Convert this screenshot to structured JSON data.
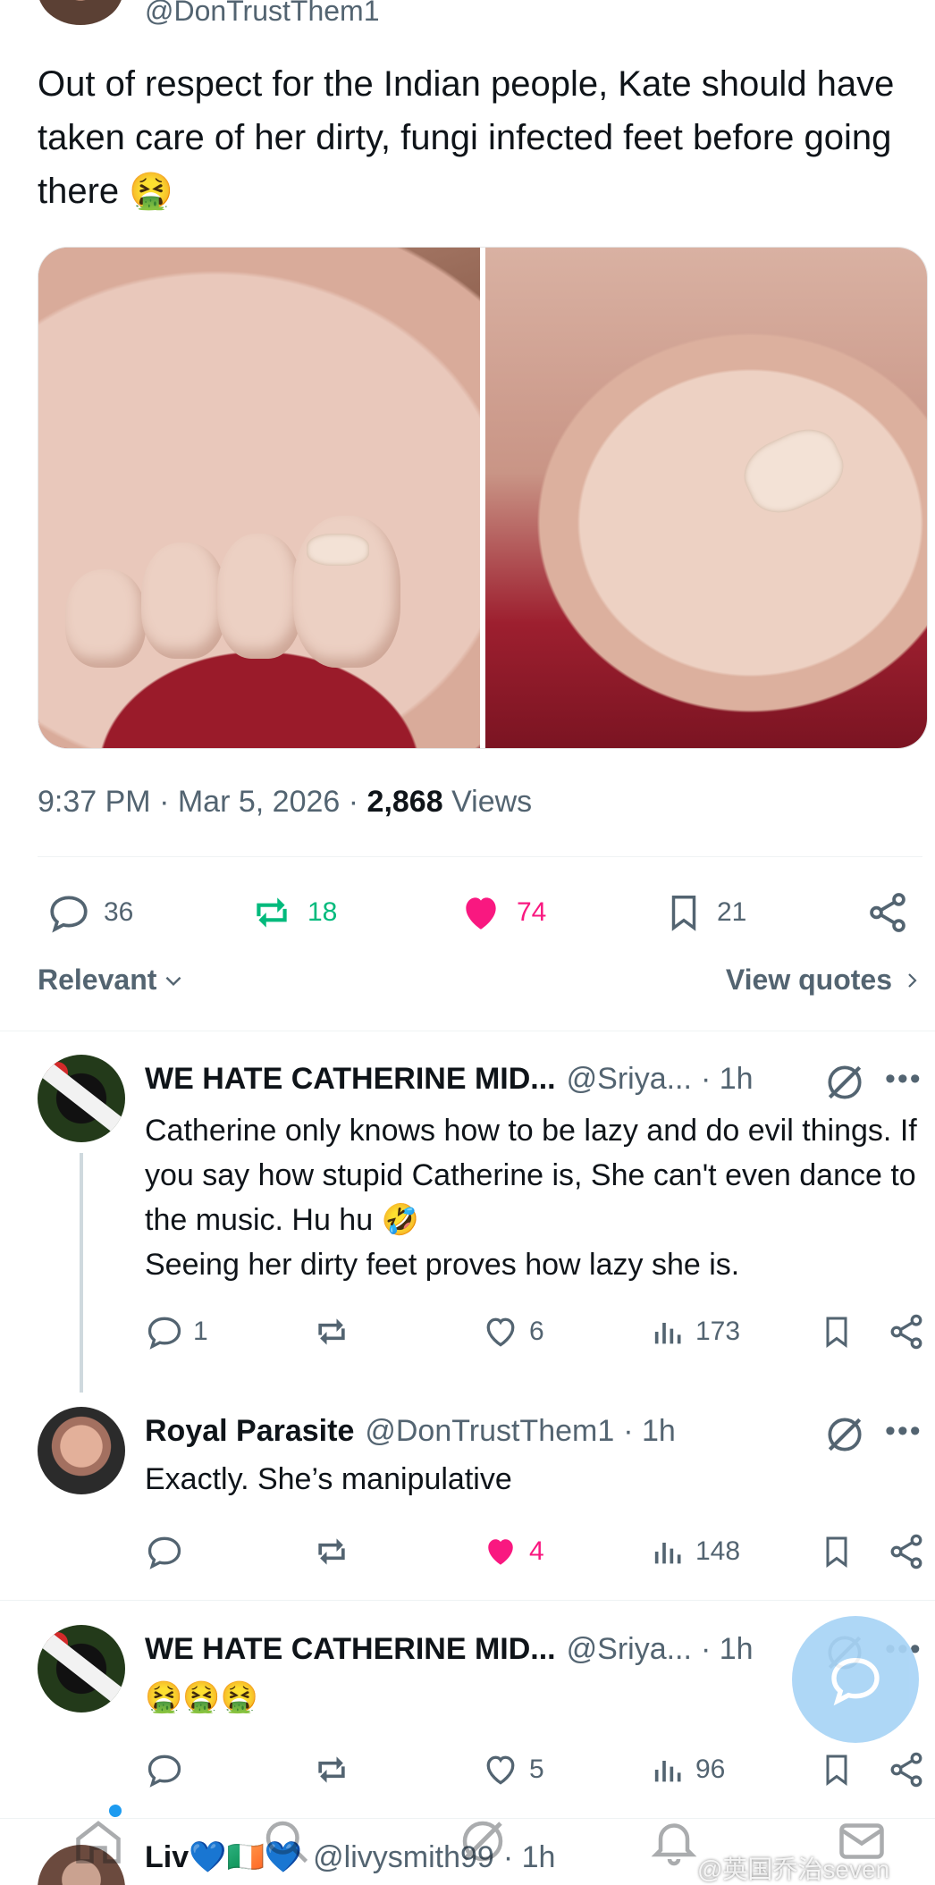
{
  "main_tweet": {
    "handle": "@DonTrustThem1",
    "text": "Out of respect for the Indian people, Kate should have taken care of her dirty, fungi infected feet before going there 🤮",
    "time": "9:37 PM",
    "date": "Mar 5, 2026",
    "views_count": "2,868",
    "views_label": "Views",
    "separator": "·"
  },
  "actions": {
    "replies": "36",
    "reposts": "18",
    "likes": "74",
    "bookmarks": "21"
  },
  "sort": {
    "label": "Relevant",
    "view_quotes": "View quotes"
  },
  "replies": [
    {
      "name": "WE HATE CATHERINE MID...",
      "handle": "@Sriya...",
      "time": "· 1h",
      "text": "Catherine only knows how to be lazy and do evil things. If you say how stupid Catherine is, She can't even dance to the music. Hu  hu 🤣",
      "text2": "Seeing her dirty feet proves how lazy she is.",
      "replies": "1",
      "reposts": "",
      "likes": "6",
      "views": "173"
    },
    {
      "name": "Royal Parasite",
      "handle": "@DonTrustThem1",
      "time": "· 1h",
      "text": "Exactly. She’s manipulative",
      "replies": "",
      "reposts": "",
      "likes": "4",
      "views": "148"
    },
    {
      "name": "WE HATE CATHERINE MID...",
      "handle": "@Sriya...",
      "time": "· 1h",
      "text": "🤮🤮🤮",
      "replies": "",
      "reposts": "",
      "likes": "5",
      "views": "96"
    },
    {
      "name": "Liv💙🇮🇪💙",
      "handle": "@livysmith99",
      "time": "· 1h"
    }
  ],
  "more_label": "•••",
  "watermark": "@英国乔治seven",
  "colors": {
    "text": "#0f1419",
    "secondary": "#536471",
    "repost_active": "#00ba7c",
    "like_active": "#f91880",
    "accent": "#1d9bf0"
  }
}
